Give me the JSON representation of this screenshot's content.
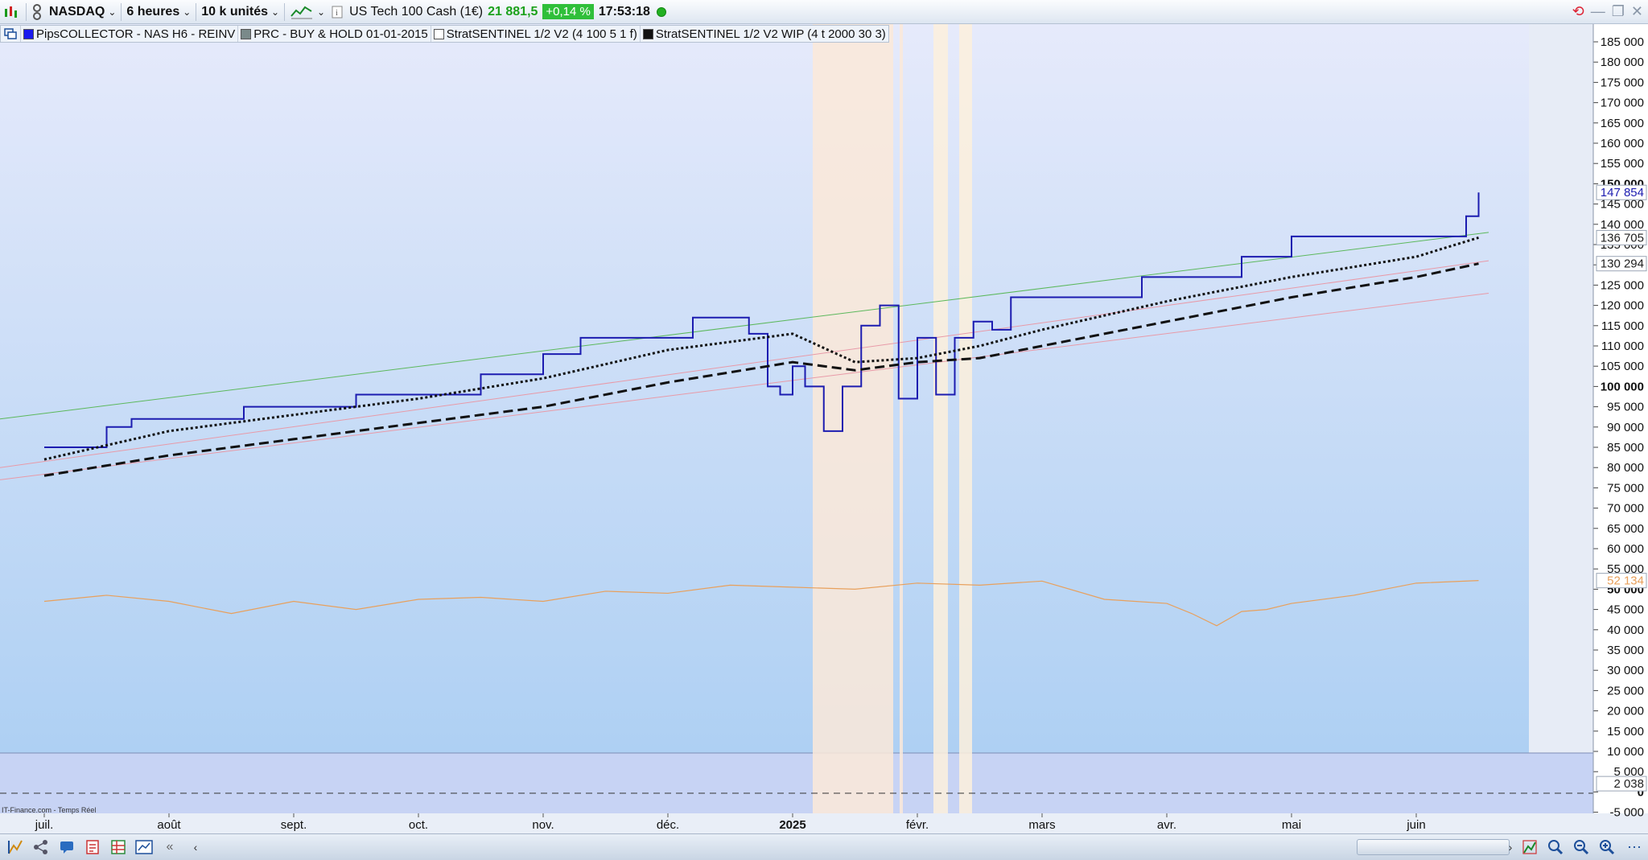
{
  "toolbar": {
    "instrument": "NASDAQ",
    "timeframe": "6 heures",
    "units": "10 k unités",
    "ticker_name": "US Tech 100 Cash (1€)",
    "price": "21 881,5",
    "change": "+0,14 %",
    "time": "17:53:18"
  },
  "legend": [
    {
      "label": "PipsCOLLECTOR - NAS H6 - REINV",
      "color": "#1a1aee"
    },
    {
      "label": "PRC - BUY & HOLD 01-01-2015",
      "color": "#7a8a8a"
    },
    {
      "label": "StratSENTINEL 1/2 V2 (4 100 5 1 f)",
      "color": "#ffffff"
    },
    {
      "label": "StratSENTINEL 1/2 V2 WIP (4 t 2000 30 3)",
      "color": "#111111"
    }
  ],
  "footer_source": "IT-Finance.com - Temps Réel",
  "colors": {
    "pips": "#1c1cb0",
    "buyhold": "#e8a05c",
    "green_line": "#5cb85c",
    "pink_line": "#e89aa8"
  },
  "chart_data": {
    "type": "line",
    "x_labels": [
      "juil.",
      "août",
      "sept.",
      "oct.",
      "nov.",
      "déc.",
      "2025",
      "févr.",
      "mars",
      "avr.",
      "mai",
      "juin"
    ],
    "x_label_bold": "2025",
    "y_ticks": [
      "185 000",
      "180 000",
      "175 000",
      "170 000",
      "165 000",
      "160 000",
      "155 000",
      "150 000",
      "145 000",
      "140 000",
      "135 000",
      "130 000",
      "125 000",
      "120 000",
      "115 000",
      "110 000",
      "105 000",
      "100 000",
      "95 000",
      "90 000",
      "85 000",
      "80 000",
      "75 000",
      "70 000",
      "65 000",
      "60 000",
      "55 000",
      "50 000",
      "45 000",
      "40 000",
      "35 000",
      "30 000",
      "25 000",
      "20 000",
      "15 000",
      "10 000",
      "5 000",
      "0",
      "-5 000"
    ],
    "y_tick_values": [
      185000,
      180000,
      175000,
      170000,
      165000,
      160000,
      155000,
      150000,
      145000,
      140000,
      135000,
      130000,
      125000,
      120000,
      115000,
      110000,
      105000,
      100000,
      95000,
      90000,
      85000,
      80000,
      75000,
      70000,
      65000,
      60000,
      55000,
      50000,
      45000,
      40000,
      35000,
      30000,
      25000,
      20000,
      15000,
      10000,
      5000,
      0,
      -5000
    ],
    "ylim": [
      -5000,
      185000
    ],
    "value_labels": [
      {
        "text": "147 854",
        "value": 147854,
        "color": "#1c1cb0"
      },
      {
        "text": "136 705",
        "value": 136705,
        "color": "#222222"
      },
      {
        "text": "130 294",
        "value": 130294,
        "color": "#222222"
      },
      {
        "text": "52 134",
        "value": 52134,
        "color": "#e8a05c"
      },
      {
        "text": "2 038",
        "value": 2038,
        "color": "#222222"
      }
    ],
    "series": [
      {
        "name": "PipsCOLLECTOR - NAS H6 - REINV",
        "x": [
          0,
          0.3,
          0.5,
          0.7,
          1.0,
          1.3,
          1.6,
          1.9,
          2.1,
          2.5,
          2.8,
          3.0,
          3.3,
          3.5,
          3.8,
          4.0,
          4.3,
          4.6,
          4.9,
          5.2,
          5.4,
          5.6,
          5.65,
          5.8,
          5.9,
          6.0,
          6.1,
          6.25,
          6.4,
          6.55,
          6.7,
          6.85,
          7.0,
          7.15,
          7.3,
          7.45,
          7.6,
          7.75,
          7.9,
          8.1,
          8.4,
          8.8,
          9.2,
          9.6,
          10.0,
          10.4,
          10.8,
          11.2,
          11.4,
          11.5
        ],
        "y": [
          85000,
          85000,
          90000,
          92000,
          92000,
          92000,
          95000,
          95000,
          95000,
          98000,
          98000,
          98000,
          98000,
          103000,
          103000,
          108000,
          112000,
          112000,
          112000,
          117000,
          117000,
          117000,
          113000,
          100000,
          98000,
          105000,
          100000,
          89000,
          100000,
          115000,
          120000,
          97000,
          112000,
          98000,
          112000,
          116000,
          114000,
          122000,
          122000,
          122000,
          122000,
          127000,
          127000,
          132000,
          137000,
          137000,
          137000,
          137000,
          142000,
          147854
        ]
      },
      {
        "name": "PRC - BUY & HOLD 01-01-2015",
        "x": [
          0,
          0.5,
          1.0,
          1.5,
          2.0,
          2.5,
          3.0,
          3.5,
          4.0,
          4.5,
          5.0,
          5.5,
          6.0,
          6.5,
          7.0,
          7.5,
          8.0,
          8.5,
          9.0,
          9.2,
          9.4,
          9.6,
          9.8,
          10.0,
          10.5,
          11.0,
          11.5
        ],
        "y": [
          47000,
          48500,
          47000,
          44000,
          47000,
          45000,
          47500,
          48000,
          47000,
          49500,
          49000,
          51000,
          50500,
          50000,
          51500,
          51000,
          52000,
          47500,
          46500,
          44000,
          41000,
          44500,
          45000,
          46500,
          48500,
          51500,
          52134
        ]
      },
      {
        "name": "StratSENTINEL 1/2 V2 (4 100 5 1 f)",
        "x": [
          0,
          1,
          2,
          3,
          4,
          5,
          6,
          6.5,
          7,
          7.5,
          8,
          9,
          10,
          11,
          11.5
        ],
        "y": [
          82000,
          89000,
          93000,
          97000,
          102000,
          109000,
          113000,
          106000,
          107000,
          110000,
          114000,
          121000,
          127000,
          132000,
          136705
        ]
      },
      {
        "name": "StratSENTINEL 1/2 V2 WIP (4 t 2000 30 3)",
        "x": [
          0,
          1,
          2,
          3,
          4,
          5,
          6,
          6.5,
          7,
          7.5,
          8,
          9,
          10,
          11,
          11.5
        ],
        "y": [
          78000,
          83000,
          87000,
          91000,
          95000,
          101000,
          106000,
          104000,
          106000,
          107000,
          110000,
          116000,
          122000,
          127000,
          130294
        ]
      }
    ],
    "grid": false,
    "legend_position": "top-left"
  }
}
